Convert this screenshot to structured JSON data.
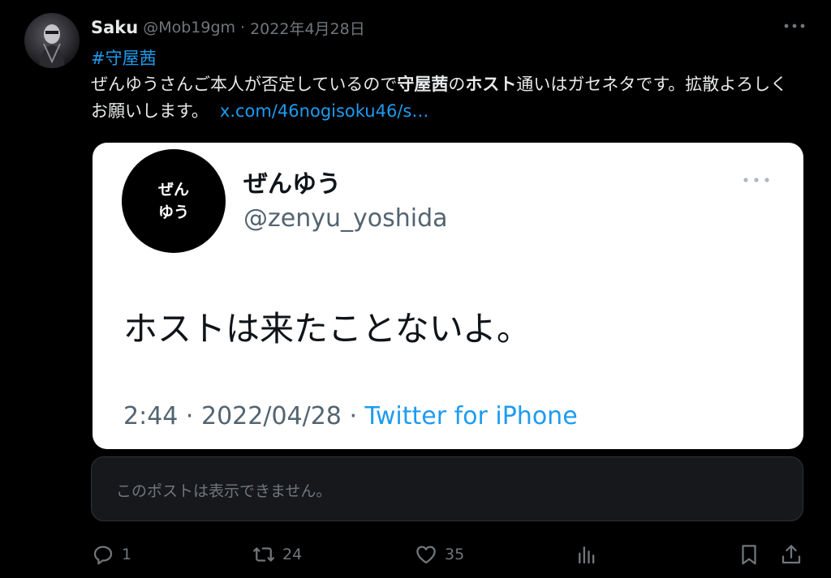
{
  "tweet": {
    "author_name": "Saku",
    "author_handle": "@Mob19gm",
    "separator": "·",
    "date": "2022年4月28日",
    "hashtag": "#守屋茜",
    "text_part1": "ぜんゆうさんご本人が否定しているので",
    "text_bold1": "守屋茜",
    "text_part2": "の",
    "text_bold2": "ホスト",
    "text_part3": "通いはガセネタです。拡散よろしくお願いします。",
    "link_text": "x.com/46nogisoku46/s…"
  },
  "card": {
    "avatar_line1": "ぜん",
    "avatar_line2": "ゆう",
    "name": "ぜんゆう",
    "handle": "@zenyu_yoshida",
    "body": "ホストは来たことないよ。",
    "time": "2:44",
    "date": "2022/04/28",
    "source": "Twitter for iPhone",
    "separator": " · "
  },
  "unavailable": {
    "text": "このポストは表示できません。"
  },
  "actions": {
    "replies": "1",
    "reposts": "24",
    "likes": "35"
  },
  "icons": {
    "more_top": "more-horizontal-icon",
    "card_more": "more-horizontal-icon",
    "reply": "reply-icon",
    "repost": "repost-icon",
    "like": "heart-icon",
    "views": "views-icon",
    "bookmark": "bookmark-icon",
    "share": "share-icon"
  },
  "colors": {
    "background": "#000000",
    "text": "#e7e9ea",
    "muted": "#71767b",
    "link": "#1d9bf0",
    "card_bg": "#ffffff"
  }
}
